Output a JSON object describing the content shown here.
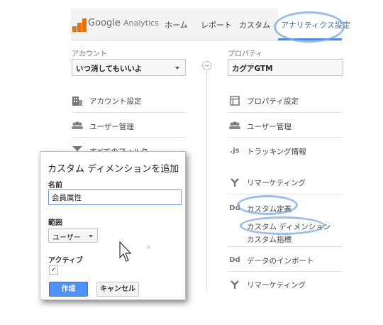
{
  "header": {
    "brand": "Google",
    "brand_sub": "Analytics",
    "nav": [
      "ホーム",
      "レポート",
      "カスタム",
      "アナリティクス設定"
    ]
  },
  "account": {
    "label": "アカウント",
    "selected": "いつ消してもいいよ",
    "items": [
      {
        "icon": "building-icon",
        "label": "アカウント設定"
      },
      {
        "icon": "users-icon",
        "label": "ユーザー管理"
      },
      {
        "icon": "filter-icon",
        "label": "すべてのフィルタ"
      }
    ]
  },
  "property": {
    "label": "プロパティ",
    "selected": "カグアGTM",
    "items": [
      {
        "icon": "property-icon",
        "label": "プロパティ設定"
      },
      {
        "icon": "users-icon",
        "label": "ユーザー管理"
      },
      {
        "icon": "js-icon",
        "icon_text": ".js",
        "label": "トラッキング情報"
      },
      {
        "icon": "remarketing-icon",
        "label": "リマーケティング"
      },
      {
        "icon": "custom-definitions-icon",
        "icon_text": "Dd",
        "label": "カスタム定義"
      },
      {
        "icon": "data-import-icon",
        "icon_text": "Dd",
        "label": "データのインポート"
      },
      {
        "icon": "remarketing-icon",
        "label": "リマーケティング"
      }
    ],
    "sub_items": [
      "カスタム ディメンション",
      "カスタム指標"
    ]
  },
  "dialog": {
    "title": "カスタム ディメンションを追加",
    "name_label": "名前",
    "name_value": "会員属性",
    "scope_label": "範囲",
    "scope_value": "ユーザー",
    "active_label": "アクティブ",
    "active_checked": true,
    "check_glyph": "✓",
    "create_label": "作成",
    "cancel_label": "キャンセル"
  },
  "colors": {
    "accent": "#4d90fe",
    "highlight_oval": "#7aa7e0",
    "logo": "#e8710a"
  }
}
